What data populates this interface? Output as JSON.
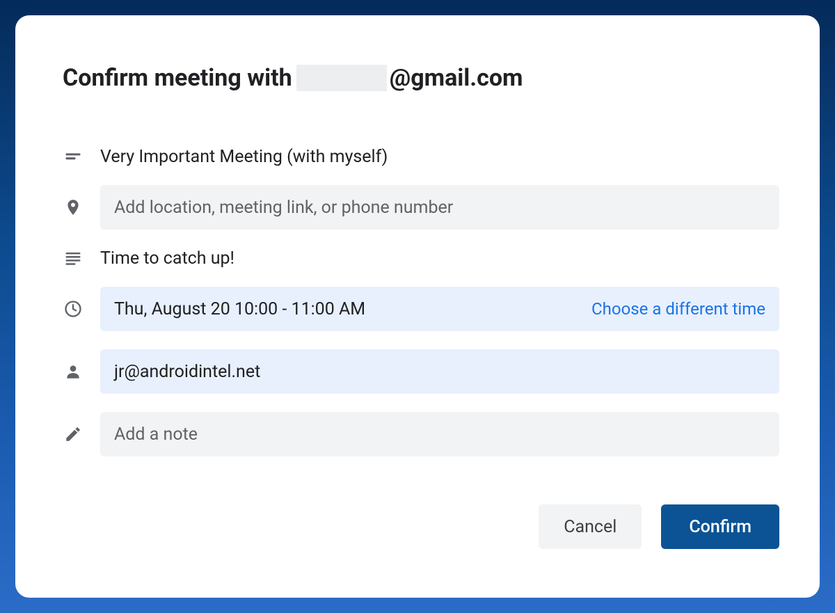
{
  "header": {
    "prefix": "Confirm meeting with",
    "redacted": true,
    "suffix": "@gmail.com"
  },
  "subject": {
    "value": "Very Important Meeting (with myself)"
  },
  "location": {
    "placeholder": "Add location, meeting link, or phone number",
    "value": ""
  },
  "description": {
    "value": "Time to catch up!"
  },
  "time": {
    "value": "Thu, August 20 10:00 - 11:00 AM",
    "choose_label": "Choose a different time"
  },
  "attendee": {
    "value": "jr@androidintel.net"
  },
  "note": {
    "placeholder": "Add a note",
    "value": ""
  },
  "actions": {
    "cancel": "Cancel",
    "confirm": "Confirm"
  }
}
